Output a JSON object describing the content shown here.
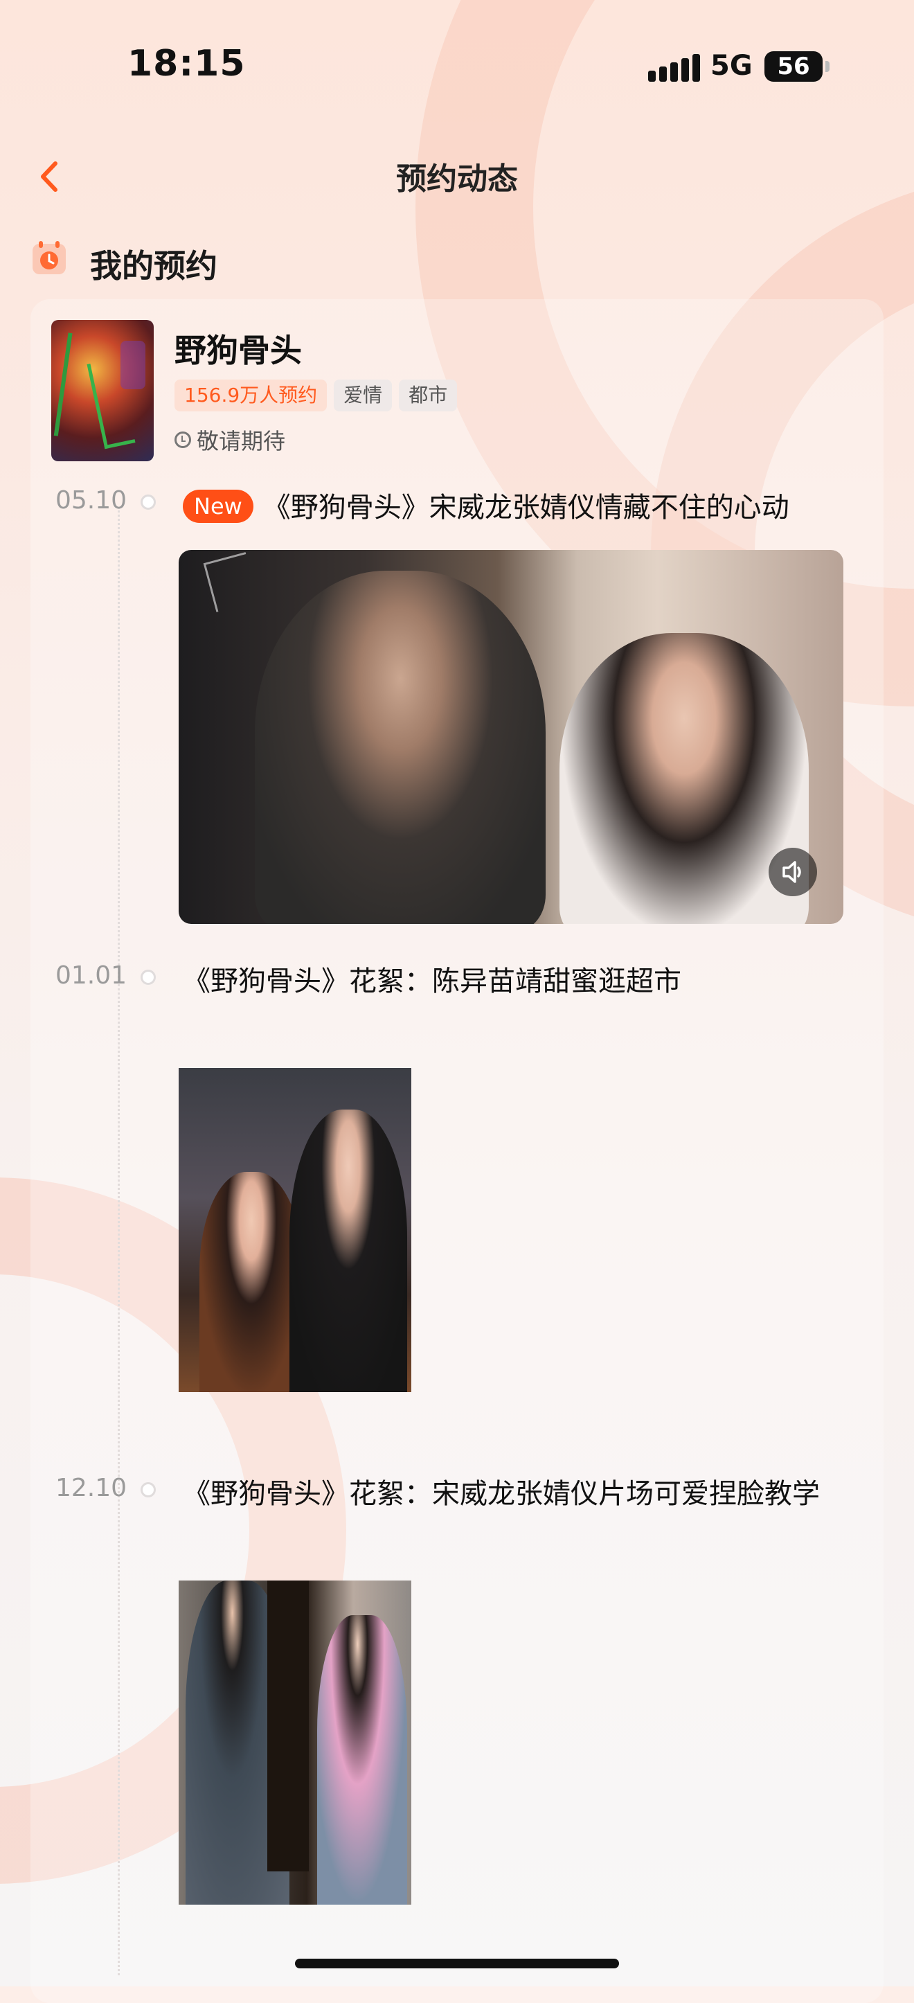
{
  "status_bar": {
    "time": "18:15",
    "network": "5G",
    "battery": "56"
  },
  "nav": {
    "title": "预约动态",
    "back_icon": "chevron-left-icon"
  },
  "section": {
    "title": "我的预约",
    "icon": "calendar-clock-icon"
  },
  "show": {
    "title": "野狗骨头",
    "reservations": "156.9万人预约",
    "tags": [
      "爱情",
      "都市"
    ],
    "release_status": "敬请期待"
  },
  "timeline": [
    {
      "date": "05.10",
      "badge": "New",
      "title": "《野狗骨头》宋威龙张婧仪情藏不住的心动",
      "media": "video"
    },
    {
      "date": "01.01",
      "badge": "",
      "title": "《野狗骨头》花絮：陈异苗靖甜蜜逛超市",
      "media": "image"
    },
    {
      "date": "12.10",
      "badge": "",
      "title": "《野狗骨头》花絮：宋威龙张婧仪片场可爱捏脸教学",
      "media": "image"
    }
  ],
  "colors": {
    "accent": "#ff4f16",
    "accent_tag_bg": "#fde0d4",
    "text": "#111111"
  }
}
